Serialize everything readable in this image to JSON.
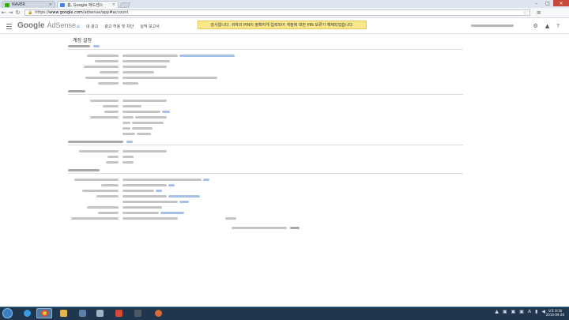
{
  "browser": {
    "tabs": [
      {
        "label": "NAVER",
        "favicon_color": "#2db400"
      },
      {
        "label": "홈, Google 애드센스",
        "favicon_color": "#4285f4"
      }
    ],
    "url_scheme": "https://",
    "url_domain": "www.google.com",
    "url_path": "/adsense/app#account",
    "window_controls": {
      "minimize": "–",
      "maximize": "□",
      "close": "✕"
    }
  },
  "header": {
    "logo_google": "Google",
    "logo_product": "AdSense",
    "nav": [
      "내 광고",
      "광고 허용 및 차단",
      "실적 보고서"
    ],
    "notice": "감사합니다. 귀하의 PIN이 정확하게 입력되어 계정에 대한 PIN 보류가 해제되었습니다."
  },
  "page": {
    "title": "계정 설정"
  },
  "colors": {
    "notice_bg": "#fbe88a",
    "link": "#3b7bd6",
    "taskbar": "#20364f"
  },
  "taskbar": {
    "clock_time": "오후 8:30",
    "clock_date": "2014-09-26"
  }
}
